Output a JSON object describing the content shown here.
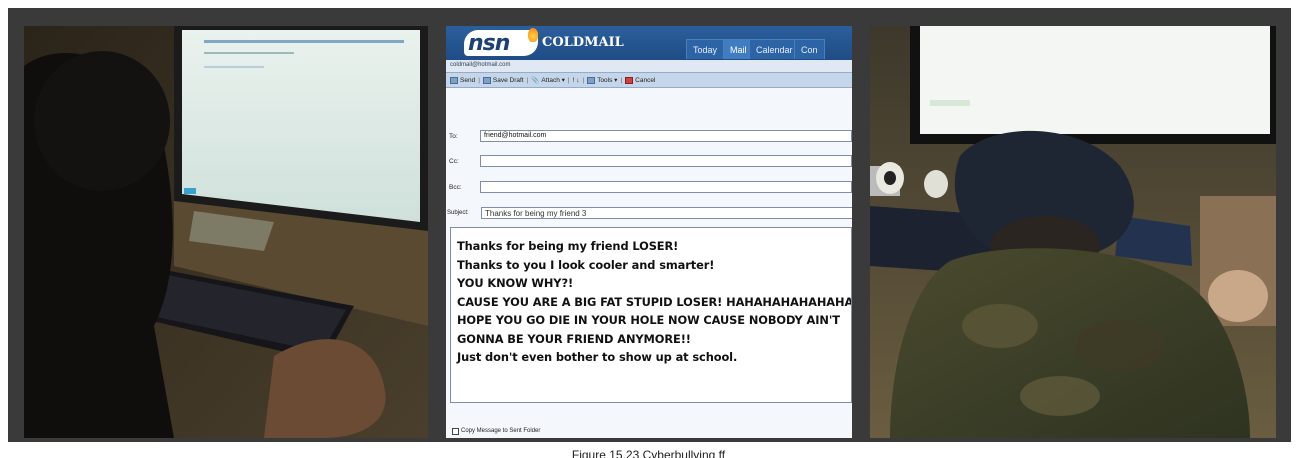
{
  "colors": {
    "frame": "#3a3a3a",
    "mail_header": "#1f4c86",
    "toolbar": "#c6d6ea",
    "page": "#ffffff"
  },
  "photos": {
    "left": {
      "scene": "person-at-desk-typing"
    },
    "right": {
      "scene": "person-head-down-on-desk"
    }
  },
  "email": {
    "logo_brand": "nsn",
    "logo_product": "COLDMAIL",
    "tabs": [
      "Today",
      "Mail",
      "Calendar",
      "Con"
    ],
    "account": "coldmail@hotmail.com",
    "toolbar": {
      "send": "Send",
      "save_draft": "Save Draft",
      "attach": "Attach ▾",
      "priority": "! ↓",
      "tools": "Tools ▾",
      "cancel": "Cancel",
      "icons": [
        "send-icon",
        "save-draft-icon",
        "attach-icon",
        "tools-icon",
        "cancel-icon"
      ]
    },
    "fields": {
      "to_label": "To:",
      "to_value": "friend@hotmail.com",
      "cc_label": "Cc:",
      "cc_value": "",
      "bcc_label": "Bcc:",
      "bcc_value": "",
      "subject_label": "Subject:",
      "subject_value": "Thanks for being my friend 3"
    },
    "body_lines": [
      "Thanks for being my friend LOSER!",
      "Thanks to you I look cooler and smarter!",
      "YOU KNOW WHY?!",
      "CAUSE YOU ARE A BIG FAT STUPID LOSER! HAHAHAHAHAHAHA",
      "HOPE YOU GO DIE IN YOUR HOLE NOW CAUSE NOBODY AIN'T",
      "GONNA BE YOUR FRIEND ANYMORE!!",
      "Just don't even bother to show up at school."
    ],
    "copy_to_sent_label": "Copy Message to Sent Folder",
    "copy_to_sent_checked": false
  },
  "caption": "Figure 15.23 Cyberbullying ff"
}
